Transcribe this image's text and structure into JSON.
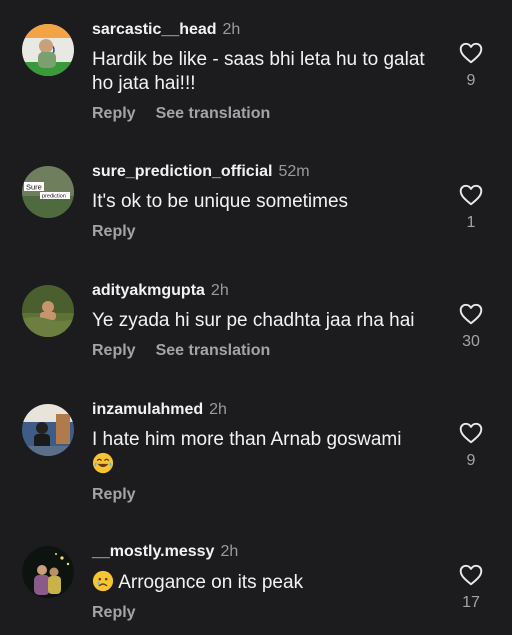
{
  "comments": [
    {
      "username": "sarcastic__head",
      "time": "2h",
      "text": "Hardik be like - saas bhi leta hu to galat ho jata hai!!!",
      "reply": "Reply",
      "translation": "See translation",
      "likes": "9",
      "avatar": "green-flag-avatar"
    },
    {
      "username": "sure_prediction_official",
      "time": "52m",
      "text": "It's ok to be unique sometimes",
      "reply": "Reply",
      "likes": "1",
      "avatar_label": "Sure",
      "avatar_label2": "prediction"
    },
    {
      "username": "adityakmgupta",
      "time": "2h",
      "text": "Ye zyada hi sur pe chadhta jaa rha hai",
      "reply": "Reply",
      "translation": "See translation",
      "likes": "30",
      "avatar": "swimmer-avatar"
    },
    {
      "username": "inzamulahmed",
      "time": "2h",
      "text": "I hate him more than Arnab goswami",
      "emoji": "laughing-tears-emoji",
      "reply": "Reply",
      "likes": "9",
      "avatar": "room-avatar"
    },
    {
      "username": "__mostly.messy",
      "time": "2h",
      "emoji": "crying-face-emoji",
      "text": "Arrogance on its peak",
      "reply": "Reply",
      "likes": "17",
      "avatar": "night-lights-avatar"
    }
  ],
  "colors": {
    "background": "#1c1c1e",
    "text": "#f2f2f2",
    "muted": "#a4a4a4"
  }
}
